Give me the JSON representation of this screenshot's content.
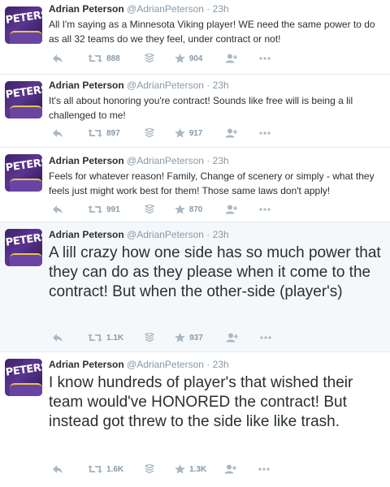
{
  "tweets": [
    {
      "name": "Adrian Peterson",
      "handle": "@AdrianPeterson",
      "time": "23h",
      "text": "All I'm saying as a Minnesota Viking player! WE need the same power to do as all 32 teams do we they feel, under contract or not!",
      "retweets": "888",
      "favorites": "904",
      "avatar_text": "PETERSON"
    },
    {
      "name": "Adrian Peterson",
      "handle": "@AdrianPeterson",
      "time": "23h",
      "text": "It's all about honoring you're contract! Sounds like free will is being a lil challenged to me!",
      "retweets": "897",
      "favorites": "917",
      "avatar_text": "PETERSON"
    },
    {
      "name": "Adrian Peterson",
      "handle": "@AdrianPeterson",
      "time": "23h",
      "text": "Feels for whatever reason! Family, Change of scenery or simply - what they feels just might work best for them! Those same laws don't apply!",
      "retweets": "991",
      "favorites": "870",
      "avatar_text": "PETERSON"
    },
    {
      "name": "Adrian Peterson",
      "handle": "@AdrianPeterson",
      "time": "23h",
      "text": "A lill crazy how one side has so much power that they can do as they please when it come to the contract! But when the other-side (player's)",
      "retweets": "1.1K",
      "favorites": "937",
      "avatar_text": "PETERSON"
    },
    {
      "name": "Adrian Peterson",
      "handle": "@AdrianPeterson",
      "time": "23h",
      "text": "I know hundreds of player's that wished their team would've HONORED the contract! But instead got threw to the side like like trash.",
      "retweets": "1.6K",
      "favorites": "1.3K",
      "avatar_text": "PETERSON"
    }
  ],
  "separator": "·",
  "colors": {
    "name": "#292f33",
    "meta": "#8899a6",
    "icon": "#aab8c2",
    "border": "#e1e8ed",
    "expanded_bg": "#f5f8fa"
  }
}
